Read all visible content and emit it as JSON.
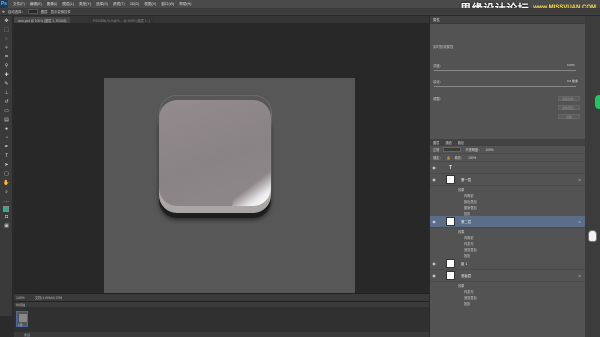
{
  "menubar": {
    "logo": "Ps",
    "items": [
      "文件(F)",
      "编辑(E)",
      "图像(I)",
      "图层(L)",
      "类型(Y)",
      "选择(S)",
      "滤镜(T)",
      "3D(D)",
      "视图(V)",
      "窗口(W)",
      "帮助(H)"
    ]
  },
  "watermark": {
    "text": "思缘设计论坛",
    "url": "www.MISSVUAN.COM"
  },
  "options": {
    "auto_select": "自动选择：",
    "target": "图层",
    "show_transform": "显示变换控件"
  },
  "tabs": [
    {
      "label": "icon.psd @ 100% (图层 1, RGB/8)",
      "active": true
    },
    {
      "label": "PS0053b.%-%@%... @ 100% (图层 1...)",
      "active": false
    }
  ],
  "status": {
    "zoom": "100%",
    "doc": "文档:1.60M/4.37M"
  },
  "timeline": {
    "title": "时间轴",
    "frame_label": "0 秒",
    "footer": "永远"
  },
  "properties": {
    "tab": "属性",
    "title": "实时形状属性",
    "density_label": "浓度：",
    "density_value": "100%",
    "feather_label": "羽化：",
    "feather_value": "0.0 像素",
    "refine_label": "调整：",
    "buttons": [
      "蒙版边缘...",
      "颜色范围...",
      "反相"
    ]
  },
  "layers": {
    "tabs": [
      "图层",
      "通道",
      "路径"
    ],
    "kind": "正常",
    "opacity_label": "不透明度：",
    "opacity": "100%",
    "lock_label": "锁定：",
    "fill_label": "填充：",
    "fill": "100%",
    "items": [
      {
        "name": "",
        "thumb": "T",
        "type": "text",
        "selected": false,
        "fx": false,
        "effects": []
      },
      {
        "name": "第一层",
        "thumb": "",
        "type": "shape",
        "selected": false,
        "fx": true,
        "effects": [
          "效果",
          "内阴影",
          "颜色叠加",
          "图案叠加",
          "投影"
        ]
      },
      {
        "name": "第二层",
        "thumb": "",
        "type": "shape",
        "selected": true,
        "fx": true,
        "effects": [
          "效果",
          "内阴影",
          "内发光",
          "渐变叠加",
          "投影"
        ]
      },
      {
        "name": "组 1",
        "thumb": "",
        "type": "group",
        "selected": false,
        "fx": false,
        "effects": []
      },
      {
        "name": "底板层",
        "thumb": "",
        "type": "shape",
        "selected": false,
        "fx": true,
        "effects": [
          "效果",
          "内发光",
          "渐变叠加",
          "投影"
        ]
      }
    ]
  },
  "colors": {
    "canvas": "#575757",
    "icon_face": "#8d8688",
    "foreground_swatch": "#1fb08b",
    "selected_layer": "#5b6d89",
    "green_button": "#22c55e"
  }
}
